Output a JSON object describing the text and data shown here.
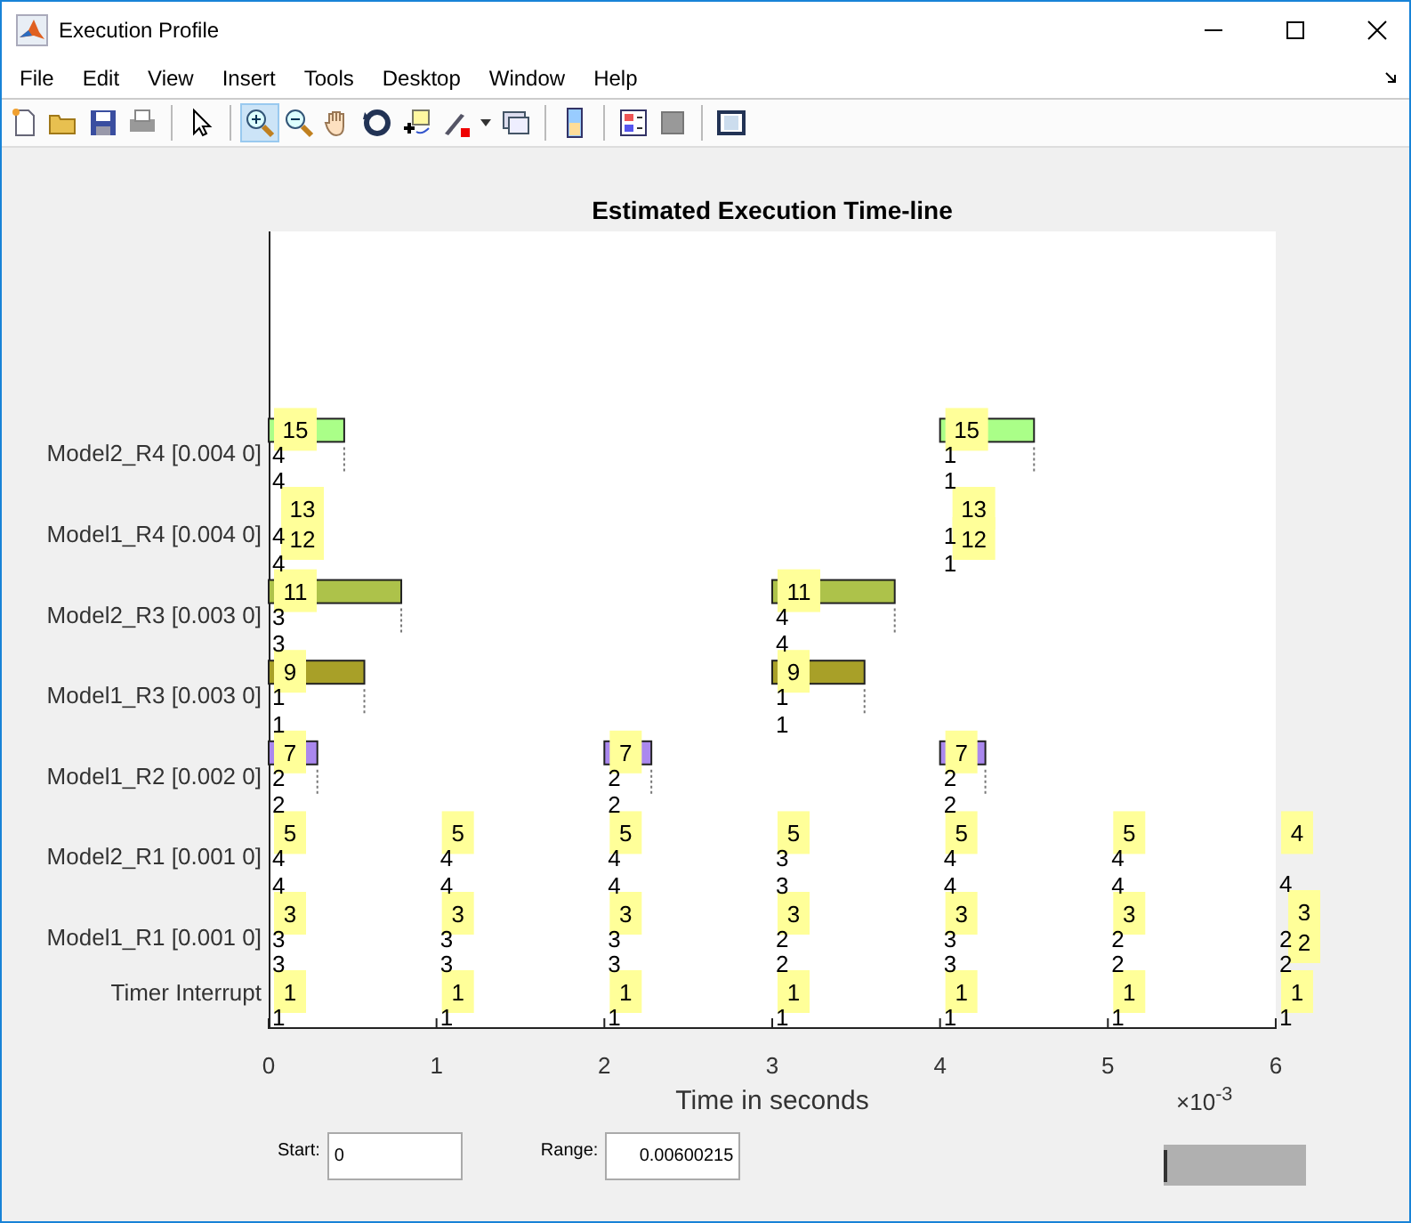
{
  "window": {
    "title": "Execution Profile"
  },
  "menu": [
    "File",
    "Edit",
    "View",
    "Insert",
    "Tools",
    "Desktop",
    "Window",
    "Help"
  ],
  "toolbar": [
    {
      "selected": false
    },
    {
      "selected": false
    },
    {
      "selected": false
    },
    {
      "selected": false
    },
    {
      "selected": false
    },
    {
      "selected": true
    },
    {
      "selected": false
    },
    {
      "selected": false
    },
    {
      "selected": false
    },
    {
      "selected": false
    },
    {
      "selected": false
    },
    {
      "selected": false
    },
    {
      "selected": false
    },
    {
      "selected": false
    },
    {
      "selected": false
    },
    {
      "selected": false
    }
  ],
  "chart": {
    "title": "Estimated Execution Time-line",
    "xlabel": "Time in seconds",
    "exponent": "×10$^{-3}$",
    "xticks": [
      "0",
      "1",
      "2",
      "3",
      "4",
      "5",
      "6"
    ],
    "rows": [
      {
        "name": "Model2_R4 [0.004 0]",
        "cells": [
          {
            "labels": [
              "15"
            ],
            "low": "4",
            "level": 0.45,
            "color": "#aaff88"
          },
          null,
          null,
          null,
          {
            "labels": [
              "15"
            ],
            "low": "1",
            "level": 0.56,
            "color": "#aaff88"
          },
          null,
          null
        ]
      },
      {
        "name": "Model1_R4 [0.004 0]",
        "cells": [
          {
            "labels": [
              "13",
              "12"
            ],
            "low": "4",
            "high": "4"
          },
          null,
          null,
          null,
          {
            "labels": [
              "13",
              "12"
            ],
            "low": "1",
            "high": "1"
          },
          null,
          null
        ]
      },
      {
        "name": "Model2_R3 [0.003 0]",
        "cells": [
          {
            "labels": [
              "11"
            ],
            "low": "3",
            "high": "4",
            "level": 0.79,
            "color": "#adc24a"
          },
          null,
          null,
          {
            "labels": [
              "11"
            ],
            "low": "4",
            "level": 0.73,
            "color": "#adc24a"
          },
          {
            "high": "1"
          },
          null,
          null
        ]
      },
      {
        "name": "Model1_R3 [0.003 0]",
        "cells": [
          {
            "labels": [
              "9"
            ],
            "low": "1",
            "high": "3",
            "level": 0.57,
            "color": "#a8a028"
          },
          null,
          null,
          {
            "labels": [
              "9"
            ],
            "low": "1",
            "high": "4",
            "level": 0.55,
            "color": "#a8a028"
          },
          null,
          null,
          null
        ]
      },
      {
        "name": "Model1_R2 [0.002 0]",
        "cells": [
          {
            "labels": [
              "7"
            ],
            "low": "2",
            "high": "1",
            "level": 0.29,
            "color": "#aa88ee"
          },
          null,
          {
            "labels": [
              "7"
            ],
            "low": "2",
            "level": 0.28,
            "color": "#aa88ee"
          },
          {
            "high": "1"
          },
          {
            "labels": [
              "7"
            ],
            "low": "2",
            "level": 0.27,
            "color": "#aa88ee"
          },
          null,
          null
        ]
      },
      {
        "name": "Model2_R1 [0.001 0]",
        "cells": [
          {
            "labels": [
              "5"
            ],
            "low": "4",
            "high": "2"
          },
          {
            "labels": [
              "5"
            ],
            "low": "4"
          },
          {
            "labels": [
              "5"
            ],
            "low": "4",
            "high": "2"
          },
          {
            "labels": [
              "5"
            ],
            "low": "3"
          },
          {
            "labels": [
              "5"
            ],
            "low": "4",
            "high": "2"
          },
          {
            "labels": [
              "5"
            ],
            "low": "4"
          },
          {
            "labels": [
              "4"
            ]
          }
        ]
      },
      {
        "name": "Model1_R1 [0.001 0]",
        "cells": [
          {
            "labels": [
              "3"
            ],
            "low": "3",
            "high": "4"
          },
          {
            "labels": [
              "3"
            ],
            "low": "3",
            "high": "4"
          },
          {
            "labels": [
              "3"
            ],
            "low": "3",
            "high": "4"
          },
          {
            "labels": [
              "3"
            ],
            "low": "2",
            "high": "3"
          },
          {
            "labels": [
              "3"
            ],
            "low": "3",
            "high": "4"
          },
          {
            "labels": [
              "3"
            ],
            "low": "2",
            "high": "4"
          },
          {
            "labels": [
              "3",
              "2"
            ],
            "low": "2",
            "high": "4"
          }
        ]
      },
      {
        "name": "Timer Interrupt",
        "cells": [
          {
            "labels": [
              "1"
            ],
            "low": "1",
            "high": "3"
          },
          {
            "labels": [
              "1"
            ],
            "low": "1",
            "high": "3"
          },
          {
            "labels": [
              "1"
            ],
            "low": "1",
            "high": "3"
          },
          {
            "labels": [
              "1"
            ],
            "low": "1",
            "high": "2"
          },
          {
            "labels": [
              "1"
            ],
            "low": "1",
            "high": "3"
          },
          {
            "labels": [
              "1"
            ],
            "low": "1",
            "high": "2"
          },
          {
            "labels": [
              "1"
            ],
            "low": "1",
            "high": "2"
          }
        ]
      }
    ]
  },
  "controls": {
    "start_label": "Start:",
    "start_value": "0",
    "range_label": "Range:",
    "range_value": "0.00600215",
    "slider": {
      "level": 0
    }
  }
}
